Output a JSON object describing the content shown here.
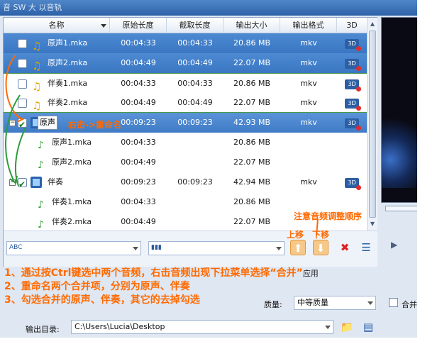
{
  "window": {
    "title": "音 SW 大  以音轨"
  },
  "table": {
    "columns": [
      "名称",
      "原始长度",
      "截取长度",
      "输出大小",
      "输出格式",
      "3D"
    ],
    "rows": [
      {
        "name": "原声1.mka",
        "orig": "00:04:33",
        "cut": "00:04:33",
        "size": "20.86 MB",
        "fmt": "mkv"
      },
      {
        "name": "原声2.mka",
        "orig": "00:04:49",
        "cut": "00:04:49",
        "size": "22.07 MB",
        "fmt": "mkv"
      },
      {
        "name": "伴奏1.mka",
        "orig": "00:04:33",
        "cut": "00:04:33",
        "size": "20.86 MB",
        "fmt": "mkv"
      },
      {
        "name": "伴奏2.mka",
        "orig": "00:04:49",
        "cut": "00:04:49",
        "size": "22.07 MB",
        "fmt": "mkv"
      },
      {
        "name": "原声",
        "orig": "00:09:23",
        "cut": "00:09:23",
        "size": "42.93 MB",
        "fmt": "mkv"
      },
      {
        "name": "原声1.mka",
        "orig": "00:04:33",
        "cut": "",
        "size": "20.86 MB",
        "fmt": ""
      },
      {
        "name": "原声2.mka",
        "orig": "00:04:49",
        "cut": "",
        "size": "22.07 MB",
        "fmt": ""
      },
      {
        "name": "伴奏",
        "orig": "00:09:23",
        "cut": "00:09:23",
        "size": "42.94 MB",
        "fmt": "mkv"
      },
      {
        "name": "伴奏1.mka",
        "orig": "00:04:33",
        "cut": "",
        "size": "20.86 MB",
        "fmt": ""
      },
      {
        "name": "伴奏2.mka",
        "orig": "00:04:49",
        "cut": "",
        "size": "22.07 MB",
        "fmt": ""
      }
    ],
    "d3_label": "3D"
  },
  "notes": {
    "rename": "右击->重命名",
    "order": "注意音频调整顺序",
    "move_up": "上移",
    "move_down": "下移",
    "step1": "1、通过按Ctrl键选中两个音频，右击音频出现下拉菜单选择“合并”",
    "step1_tail": "应用",
    "step2": "2、重命名两个合并项，分别为原声、伴奏",
    "step3": "3、勾选合并的原声、伴奏，其它的去掉勾选"
  },
  "settings": {
    "quality_label": "质量:",
    "quality_value": "中等质量",
    "merge_label": "合并",
    "output_label": "输出目录:",
    "output_path": "C:\\Users\\Lucia\\Desktop"
  },
  "colors": {
    "accent": "#3a76c2",
    "annotation": "#ff6a00",
    "ok_green": "#1c7a22"
  }
}
